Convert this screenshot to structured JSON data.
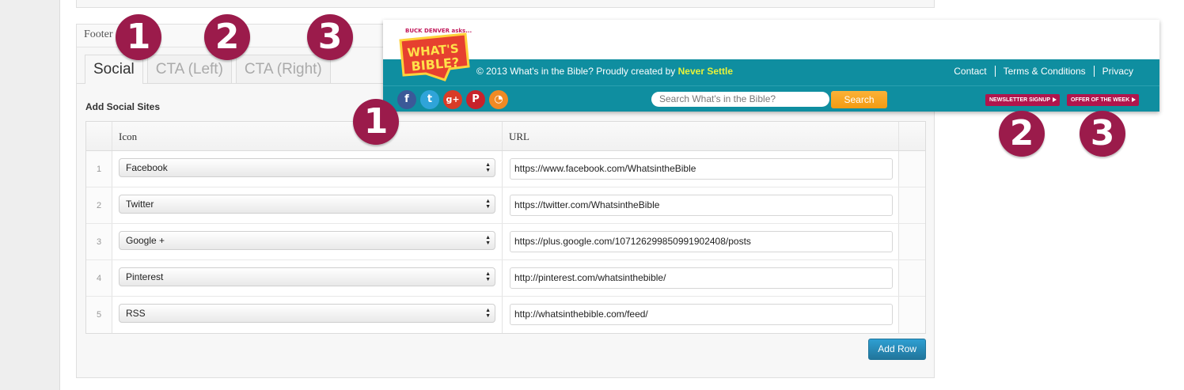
{
  "panel": {
    "title": "Footer",
    "tabs": [
      "Social",
      "CTA (Left)",
      "CTA (Right)"
    ],
    "section_title": "Add Social Sites",
    "columns": {
      "icon": "Icon",
      "url": "URL"
    },
    "rows": [
      {
        "num": "1",
        "icon": "Facebook",
        "url": "https://www.facebook.com/WhatsintheBible"
      },
      {
        "num": "2",
        "icon": "Twitter",
        "url": "https://twitter.com/WhatsintheBible"
      },
      {
        "num": "3",
        "icon": "Google +",
        "url": "https://plus.google.com/107126299850991902408/posts"
      },
      {
        "num": "4",
        "icon": "Pinterest",
        "url": "http://pinterest.com/whatsinthebible/"
      },
      {
        "num": "5",
        "icon": "RSS",
        "url": "http://whatsinthebible.com/feed/"
      }
    ],
    "add_row_label": "Add Row"
  },
  "badges": {
    "one": "1",
    "two": "2",
    "three": "3"
  },
  "site_footer": {
    "logo_small": "BUCK DENVER asks...",
    "logo_main": "WHAT'S IN THE BIBLE?",
    "copyright_text": "© 2013 What's in the Bible? Proudly created by",
    "copyright_link": "Never Settle",
    "links": [
      "Contact",
      "Terms & Conditions",
      "Privacy"
    ],
    "search_placeholder": "Search What's in the Bible?",
    "search_button": "Search",
    "social_icons": [
      {
        "name": "facebook-icon",
        "glyph": "f",
        "color": "#3b5998"
      },
      {
        "name": "twitter-icon",
        "glyph": "t",
        "color": "#2fa4d9"
      },
      {
        "name": "google-plus-icon",
        "glyph": "g+",
        "color": "#d93c27"
      },
      {
        "name": "pinterest-icon",
        "glyph": "P",
        "color": "#c8222b"
      },
      {
        "name": "rss-icon",
        "glyph": "◔",
        "color": "#f08a24"
      }
    ],
    "cta_left": "NEWSLETTER SIGNUP",
    "cta_right": "OFFER OF THE WEEK"
  },
  "colors": {
    "badge": "#9b1b4b",
    "footer_bar": "#0f8ea0",
    "button_blue": "#21759b",
    "search_orange": "#f39b12",
    "cta": "#b0154c"
  }
}
